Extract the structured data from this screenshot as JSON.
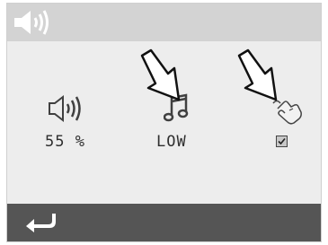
{
  "header": {
    "title_icon": "speaker-volume-icon"
  },
  "settings": {
    "volume": {
      "icon": "speaker-volume-icon",
      "value": 55,
      "value_text": "55 %"
    },
    "sound_level": {
      "icon": "music-note-icon",
      "value_text": "LOW"
    },
    "touch_sound": {
      "icon": "touch-hand-icon",
      "checked": true
    }
  },
  "pointers": [
    "arrow-down-outline-icon",
    "arrow-down-outline-icon"
  ],
  "footer": {
    "back_icon": "back-return-icon"
  },
  "colors": {
    "title_bar": "#d3d3d3",
    "background": "#ededed",
    "footer": "#555555",
    "icon_light": "#ffffff",
    "icon_dark": "#404040"
  }
}
